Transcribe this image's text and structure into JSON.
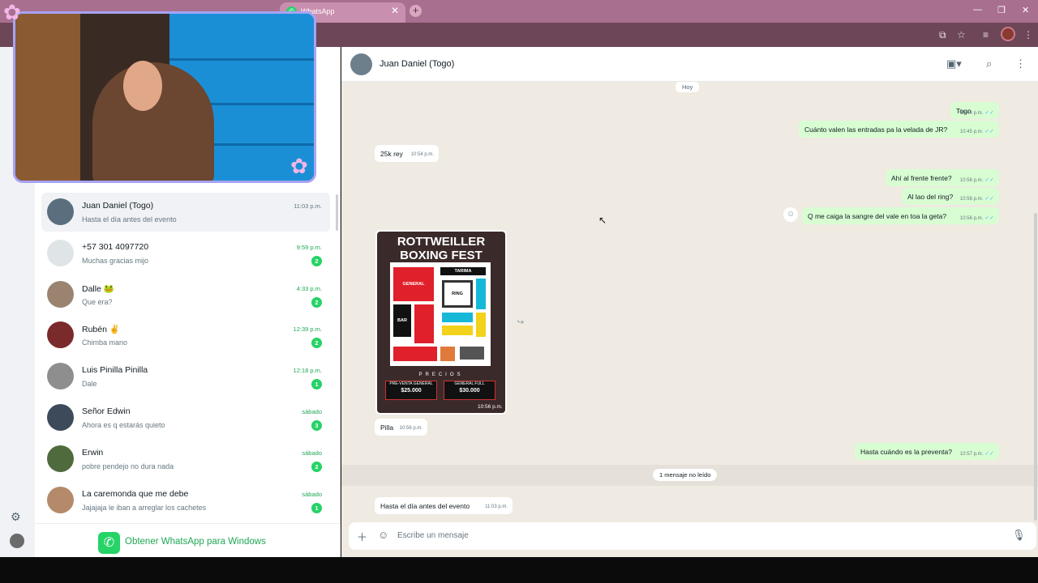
{
  "browser": {
    "tab_title": "WhatsApp",
    "tab_close": "✕",
    "new_tab": "+",
    "window_controls": [
      "—",
      "❐",
      "✕"
    ]
  },
  "left_rail": {
    "icons": [
      "chats-icon",
      "status-icon",
      "settings-icon"
    ]
  },
  "chats": [
    {
      "name": "Juan Daniel (Togo)",
      "preview": "Hasta el día antes del evento",
      "time": "11:03 p.m.",
      "unread": "",
      "active": true,
      "avatar_color": "#5a6e7d"
    },
    {
      "name": "+57 301 4097720",
      "preview": "Muchas gracias mijo",
      "time": "9:59 p.m.",
      "unread": "2",
      "active": false,
      "avatar_color": "#dfe5e7"
    },
    {
      "name": "Dalle 🐸",
      "preview": "Que era?",
      "time": "4:33 p.m.",
      "unread": "2",
      "active": false,
      "avatar_color": "#9a8470"
    },
    {
      "name": "Rubén ✌️",
      "preview": "Chimba mano",
      "time": "12:39 p.m.",
      "unread": "2",
      "active": false,
      "avatar_color": "#7a2a2a"
    },
    {
      "name": "Luis Pinilla Pinilla",
      "preview": "Dale",
      "time": "12:18 p.m.",
      "unread": "1",
      "active": false,
      "avatar_color": "#8e8e8e"
    },
    {
      "name": "Señor Edwin",
      "preview": "Ahora es q estarás quieto",
      "time": "sábado",
      "unread": "3",
      "active": false,
      "avatar_color": "#3c4a5a"
    },
    {
      "name": "Erwin",
      "preview": "pobre pendejo no dura nada",
      "time": "sábado",
      "unread": "2",
      "active": false,
      "avatar_color": "#4f6a3c"
    },
    {
      "name": "La caremonda que me debe",
      "preview": "Jajajaja le iban a arreglar los cachetes",
      "time": "sábado",
      "unread": "1",
      "active": false,
      "avatar_color": "#b48a6a"
    }
  ],
  "get_whatsapp": "Obtener WhatsApp para Windows",
  "conversation": {
    "contact_name": "Juan Daniel (Togo)",
    "date_chip": "Hoy",
    "messages": [
      {
        "dir": "out",
        "text": "Togo",
        "time": "10:44 p.m."
      },
      {
        "dir": "out",
        "text": "Cuánto valen las entradas pa la velada de JR?",
        "time": "10:45 p.m."
      },
      {
        "dir": "in",
        "text": "25k rey",
        "time": "10:54 p.m."
      },
      {
        "dir": "out",
        "text": "Ahí al frente frente?",
        "time": "10:56 p.m."
      },
      {
        "dir": "out",
        "text": "Al lao del ring?",
        "time": "10:56 p.m."
      },
      {
        "dir": "out",
        "text": "Q me caiga la sangre del vale en toa la geta?",
        "time": "10:56 p.m."
      },
      {
        "dir": "in",
        "text": "Pilla",
        "time": "10:56 p.m."
      },
      {
        "dir": "out",
        "text": "Hasta cuándo es la preventa?",
        "time": "10:57 p.m."
      },
      {
        "dir": "in",
        "text": "Hasta el día antes del evento",
        "time": "11:03 p.m."
      }
    ],
    "image": {
      "title": "ROTTWEILLER BOXING FEST",
      "labels": {
        "general": "GENERAL",
        "tarima": "TARIMA",
        "ring": "RING",
        "bar": "BAR"
      },
      "precios": "PRECIOS",
      "prices": [
        {
          "label": "PRE-VENTA GENERAL",
          "value": "$25.000"
        },
        {
          "label": "GENERAL FULL",
          "value": "$30.000"
        }
      ],
      "time": "10:56 p.m."
    },
    "unread_notice": "1 mensaje no leído",
    "composer_placeholder": "Escribe un mensaje"
  }
}
